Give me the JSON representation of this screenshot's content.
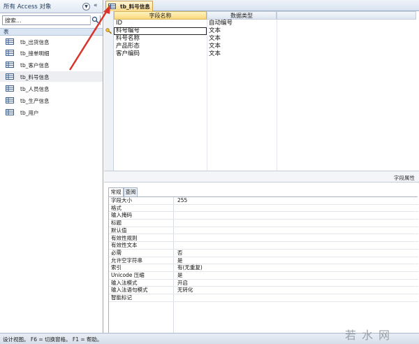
{
  "nav": {
    "title": "所有 Access 对象",
    "search_placeholder": "搜索...",
    "group_label": "表",
    "items": [
      {
        "label": "tb_出货信息"
      },
      {
        "label": "tb_接单明细"
      },
      {
        "label": "tb_客户信息"
      },
      {
        "label": "tb_料号信息"
      },
      {
        "label": "tb_人员信息"
      },
      {
        "label": "tb_生产信息"
      },
      {
        "label": "tb_用户"
      }
    ]
  },
  "document": {
    "tab_label": "tb_料号信息",
    "header": {
      "field_name": "字段名称",
      "data_type": "数据类型"
    },
    "rows": [
      {
        "name": "ID",
        "type": "自动编号"
      },
      {
        "name": "料号编号",
        "type": "文本"
      },
      {
        "name": "料号名称",
        "type": "文本"
      },
      {
        "name": "产品形态",
        "type": "文本"
      },
      {
        "name": "客户编码",
        "type": "文本"
      }
    ],
    "field_properties_label": "字段属性"
  },
  "properties": {
    "tabs": [
      "常规",
      "查阅"
    ],
    "rows": [
      {
        "label": "字段大小",
        "value": "255"
      },
      {
        "label": "格式",
        "value": ""
      },
      {
        "label": "输入掩码",
        "value": ""
      },
      {
        "label": "标题",
        "value": ""
      },
      {
        "label": "默认值",
        "value": ""
      },
      {
        "label": "有效性规则",
        "value": ""
      },
      {
        "label": "有效性文本",
        "value": ""
      },
      {
        "label": "必需",
        "value": "否"
      },
      {
        "label": "允许空字符串",
        "value": "是"
      },
      {
        "label": "索引",
        "value": "有(无重复)"
      },
      {
        "label": "Unicode 压缩",
        "value": "是"
      },
      {
        "label": "输入法模式",
        "value": "开启"
      },
      {
        "label": "输入法语句模式",
        "value": "无转化"
      },
      {
        "label": "智能标记",
        "value": ""
      }
    ]
  },
  "status": {
    "text": "设计视图。 F6 = 切换窗格。 F1 = 帮助。"
  },
  "watermark": "若水网",
  "colors": {
    "accent_tab": "#fbd98a",
    "arrow": "#d9342b"
  }
}
